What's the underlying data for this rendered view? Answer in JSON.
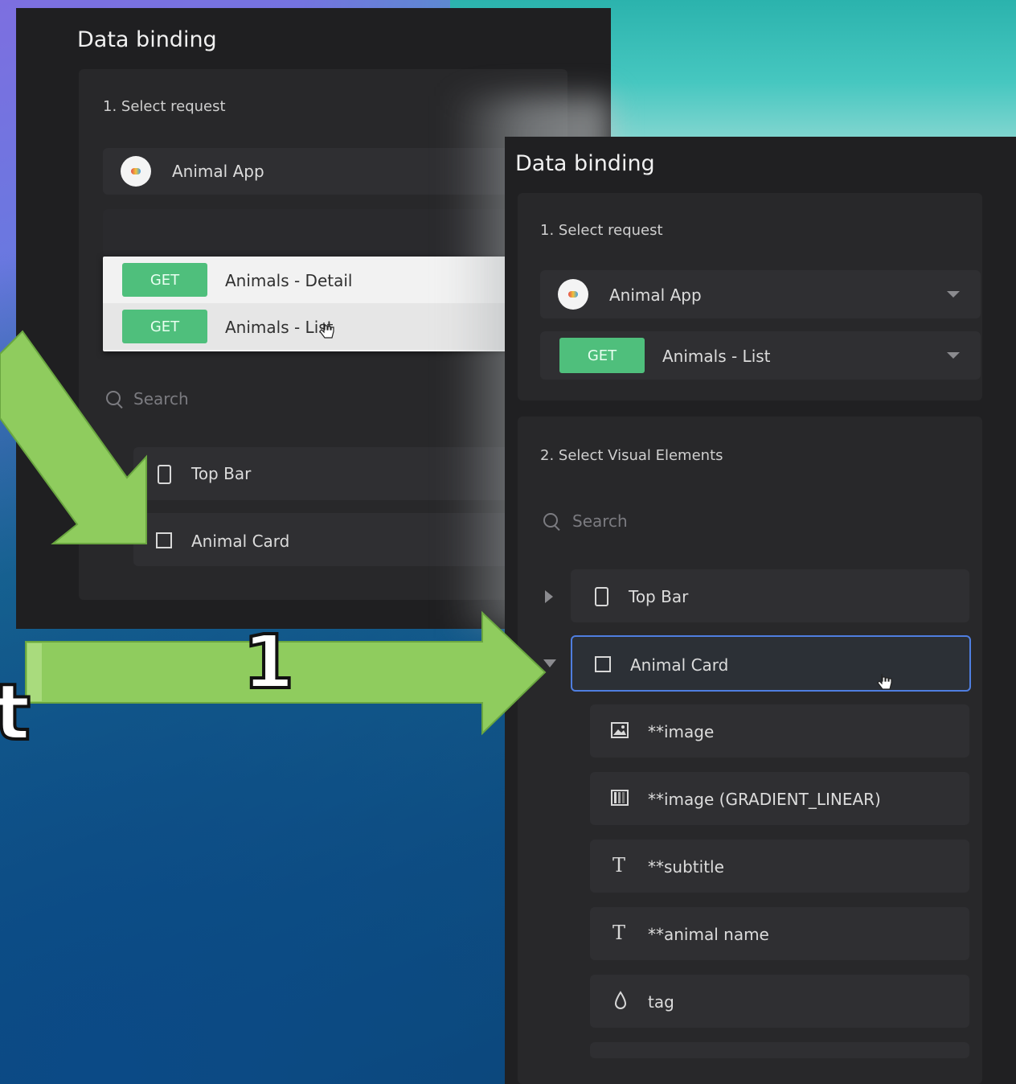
{
  "left_panel": {
    "title": "Data binding",
    "section1_label": "1. Select request",
    "app_name": "Animal App",
    "dropdown_items": [
      {
        "method": "GET",
        "label": "Animals - Detail"
      },
      {
        "method": "GET",
        "label": "Animals - List"
      }
    ],
    "search_placeholder": "Search",
    "elements": [
      {
        "label": "Top Bar",
        "icon": "phone-icon"
      },
      {
        "label": "Animal Card",
        "icon": "frame-icon"
      }
    ]
  },
  "right_panel": {
    "title": "Data binding",
    "section1_label": "1. Select request",
    "app_name": "Animal App",
    "method": "GET",
    "request_name": "Animals - List",
    "section2_label": "2. Select Visual Elements",
    "search_placeholder": "Search",
    "elements": [
      {
        "label": "Top Bar",
        "icon": "phone-icon",
        "expanded": false
      },
      {
        "label": "Animal Card",
        "icon": "frame-icon",
        "expanded": true,
        "selected": true
      }
    ],
    "children": [
      {
        "label": "**image",
        "icon": "image-icon"
      },
      {
        "label": "**image (GRADIENT_LINEAR)",
        "icon": "gradient-icon"
      },
      {
        "label": "**subtitle",
        "icon": "text-icon"
      },
      {
        "label": "**animal name",
        "icon": "text-icon"
      },
      {
        "label": "tag",
        "icon": "drop-icon"
      }
    ]
  },
  "annotation": {
    "step_number": "1",
    "edge_letter": "t",
    "arrow_color": "#8fcc5e"
  }
}
